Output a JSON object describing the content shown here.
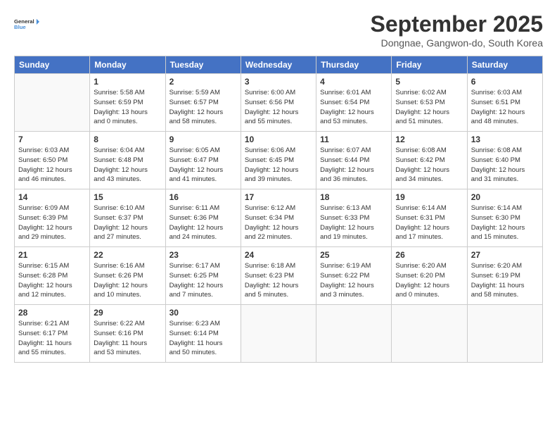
{
  "logo": {
    "line1": "General",
    "line2": "Blue"
  },
  "title": "September 2025",
  "subtitle": "Dongnae, Gangwon-do, South Korea",
  "weekdays": [
    "Sunday",
    "Monday",
    "Tuesday",
    "Wednesday",
    "Thursday",
    "Friday",
    "Saturday"
  ],
  "weeks": [
    [
      {
        "day": "",
        "info": ""
      },
      {
        "day": "1",
        "info": "Sunrise: 5:58 AM\nSunset: 6:59 PM\nDaylight: 13 hours\nand 0 minutes."
      },
      {
        "day": "2",
        "info": "Sunrise: 5:59 AM\nSunset: 6:57 PM\nDaylight: 12 hours\nand 58 minutes."
      },
      {
        "day": "3",
        "info": "Sunrise: 6:00 AM\nSunset: 6:56 PM\nDaylight: 12 hours\nand 55 minutes."
      },
      {
        "day": "4",
        "info": "Sunrise: 6:01 AM\nSunset: 6:54 PM\nDaylight: 12 hours\nand 53 minutes."
      },
      {
        "day": "5",
        "info": "Sunrise: 6:02 AM\nSunset: 6:53 PM\nDaylight: 12 hours\nand 51 minutes."
      },
      {
        "day": "6",
        "info": "Sunrise: 6:03 AM\nSunset: 6:51 PM\nDaylight: 12 hours\nand 48 minutes."
      }
    ],
    [
      {
        "day": "7",
        "info": "Sunrise: 6:03 AM\nSunset: 6:50 PM\nDaylight: 12 hours\nand 46 minutes."
      },
      {
        "day": "8",
        "info": "Sunrise: 6:04 AM\nSunset: 6:48 PM\nDaylight: 12 hours\nand 43 minutes."
      },
      {
        "day": "9",
        "info": "Sunrise: 6:05 AM\nSunset: 6:47 PM\nDaylight: 12 hours\nand 41 minutes."
      },
      {
        "day": "10",
        "info": "Sunrise: 6:06 AM\nSunset: 6:45 PM\nDaylight: 12 hours\nand 39 minutes."
      },
      {
        "day": "11",
        "info": "Sunrise: 6:07 AM\nSunset: 6:44 PM\nDaylight: 12 hours\nand 36 minutes."
      },
      {
        "day": "12",
        "info": "Sunrise: 6:08 AM\nSunset: 6:42 PM\nDaylight: 12 hours\nand 34 minutes."
      },
      {
        "day": "13",
        "info": "Sunrise: 6:08 AM\nSunset: 6:40 PM\nDaylight: 12 hours\nand 31 minutes."
      }
    ],
    [
      {
        "day": "14",
        "info": "Sunrise: 6:09 AM\nSunset: 6:39 PM\nDaylight: 12 hours\nand 29 minutes."
      },
      {
        "day": "15",
        "info": "Sunrise: 6:10 AM\nSunset: 6:37 PM\nDaylight: 12 hours\nand 27 minutes."
      },
      {
        "day": "16",
        "info": "Sunrise: 6:11 AM\nSunset: 6:36 PM\nDaylight: 12 hours\nand 24 minutes."
      },
      {
        "day": "17",
        "info": "Sunrise: 6:12 AM\nSunset: 6:34 PM\nDaylight: 12 hours\nand 22 minutes."
      },
      {
        "day": "18",
        "info": "Sunrise: 6:13 AM\nSunset: 6:33 PM\nDaylight: 12 hours\nand 19 minutes."
      },
      {
        "day": "19",
        "info": "Sunrise: 6:14 AM\nSunset: 6:31 PM\nDaylight: 12 hours\nand 17 minutes."
      },
      {
        "day": "20",
        "info": "Sunrise: 6:14 AM\nSunset: 6:30 PM\nDaylight: 12 hours\nand 15 minutes."
      }
    ],
    [
      {
        "day": "21",
        "info": "Sunrise: 6:15 AM\nSunset: 6:28 PM\nDaylight: 12 hours\nand 12 minutes."
      },
      {
        "day": "22",
        "info": "Sunrise: 6:16 AM\nSunset: 6:26 PM\nDaylight: 12 hours\nand 10 minutes."
      },
      {
        "day": "23",
        "info": "Sunrise: 6:17 AM\nSunset: 6:25 PM\nDaylight: 12 hours\nand 7 minutes."
      },
      {
        "day": "24",
        "info": "Sunrise: 6:18 AM\nSunset: 6:23 PM\nDaylight: 12 hours\nand 5 minutes."
      },
      {
        "day": "25",
        "info": "Sunrise: 6:19 AM\nSunset: 6:22 PM\nDaylight: 12 hours\nand 3 minutes."
      },
      {
        "day": "26",
        "info": "Sunrise: 6:20 AM\nSunset: 6:20 PM\nDaylight: 12 hours\nand 0 minutes."
      },
      {
        "day": "27",
        "info": "Sunrise: 6:20 AM\nSunset: 6:19 PM\nDaylight: 11 hours\nand 58 minutes."
      }
    ],
    [
      {
        "day": "28",
        "info": "Sunrise: 6:21 AM\nSunset: 6:17 PM\nDaylight: 11 hours\nand 55 minutes."
      },
      {
        "day": "29",
        "info": "Sunrise: 6:22 AM\nSunset: 6:16 PM\nDaylight: 11 hours\nand 53 minutes."
      },
      {
        "day": "30",
        "info": "Sunrise: 6:23 AM\nSunset: 6:14 PM\nDaylight: 11 hours\nand 50 minutes."
      },
      {
        "day": "",
        "info": ""
      },
      {
        "day": "",
        "info": ""
      },
      {
        "day": "",
        "info": ""
      },
      {
        "day": "",
        "info": ""
      }
    ]
  ]
}
